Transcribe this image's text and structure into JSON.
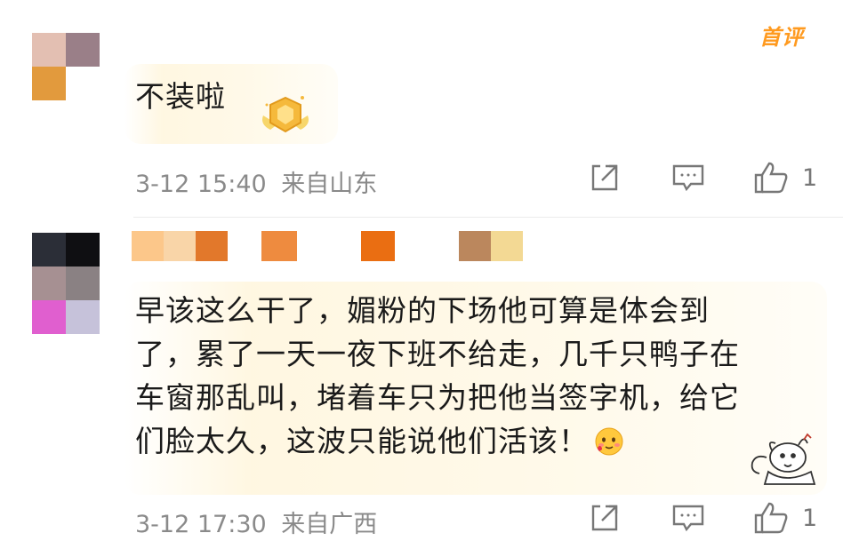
{
  "comments": [
    {
      "first_badge": "首评",
      "text": "不装啦",
      "time": "3-12 15:40",
      "location": "来自山东",
      "like_count": "1",
      "avatar_colors": [
        "#e3bfb2",
        "#9a7f88",
        "#e29a3d",
        "#ffffff"
      ],
      "icons": {
        "share": "share-icon",
        "comment": "comment-icon",
        "like": "thumb-up-icon"
      }
    },
    {
      "text_lines": [
        "早该这么干了，媚粉的下场他可算是体会到",
        "了，累了一天一夜下班不给走，几千只鸭子在",
        "车窗那乱叫，堵着车只为把他当签字机，给它",
        "们脸太久，这波只能说他们活该！"
      ],
      "time": "3-12 17:30",
      "location": "来自广西",
      "like_count": "1",
      "avatar_colors": [
        "#2b2e37",
        "#0f0f12",
        "#a69092",
        "#8a8183",
        "#e05fcf",
        "#c6c2da"
      ],
      "name_blur_colors": [
        "#fcc78a",
        "#f9d5a8",
        "#e2782b",
        "#ee8b3f",
        "#ea6e12",
        "#bb875d",
        "#f3d994"
      ],
      "icons": {
        "share": "share-icon",
        "comment": "comment-icon",
        "like": "thumb-up-icon"
      }
    }
  ]
}
